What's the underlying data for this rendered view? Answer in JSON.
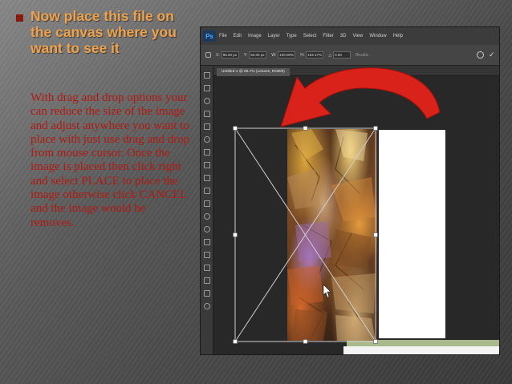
{
  "slide": {
    "title": "Now place this file on the canvas where you want to see it",
    "body": "With drag and drop options your can reduce the size of the image and adjust anywhere you want to place with just use drag and drop from mouse cursor. Once the image is placed then click right and select PLACE to place the image otherwise click CANCEL and the image would be removes.",
    "accent_color": "#f0a24a",
    "body_color": "#b11a12",
    "bullet_color": "#8a1a10"
  },
  "screenshot": {
    "app_logo": "Ps",
    "menu": [
      "File",
      "Edit",
      "Image",
      "Layer",
      "Type",
      "Select",
      "Filter",
      "3D",
      "View",
      "Window",
      "Help"
    ],
    "options": {
      "x_label": "X:",
      "x_value": "95.00 px",
      "y_label": "Y:",
      "y_value": "50.00 px",
      "w_label": "W:",
      "w_value": "100.00%",
      "h_label": "H:",
      "h_value": "104.17%",
      "angle_label": "△",
      "angle_value": "0.00",
      "interp_label": "Bicubic"
    },
    "document_tab": "Untitled-1 @ 66.7% (Leaves, RGB/8)",
    "arrow_color": "#d9231a",
    "icons": [
      "move-icon",
      "marquee-icon",
      "lasso-icon",
      "crop-icon",
      "eyedropper-icon",
      "healing-icon",
      "brush-icon",
      "stamp-icon",
      "history-brush-icon",
      "eraser-icon",
      "gradient-icon",
      "blur-icon",
      "dodge-icon",
      "pen-icon",
      "type-icon",
      "path-select-icon",
      "shape-icon",
      "hand-icon",
      "zoom-icon"
    ]
  }
}
